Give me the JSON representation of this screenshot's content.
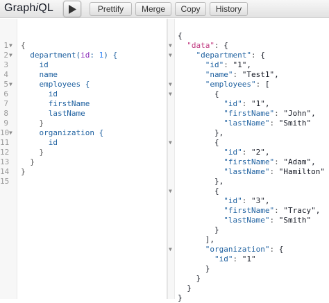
{
  "app": {
    "logo_prefix": "Graph",
    "logo_i": "i",
    "logo_suffix": "QL"
  },
  "toolbar": {
    "execute_icon": "play-icon",
    "buttons": [
      {
        "label": "Prettify"
      },
      {
        "label": "Merge"
      },
      {
        "label": "Copy"
      },
      {
        "label": "History"
      }
    ]
  },
  "query": {
    "line_numbers": [
      "1",
      "2",
      "3",
      "4",
      "5",
      "6",
      "7",
      "8",
      "9",
      "10",
      "11",
      "12",
      "13",
      "14",
      "15"
    ],
    "lines": [
      "{",
      "  department(id: 1) {",
      "    id",
      "    name",
      "    employees {",
      "      id",
      "      firstName",
      "      lastName",
      "    }",
      "    organization {",
      "      id",
      "    }",
      "  }",
      "}",
      ""
    ]
  },
  "result": {
    "lines": [
      "{",
      "  \"data\": {",
      "    \"department\": {",
      "      \"id\": \"1\",",
      "      \"name\": \"Test1\",",
      "      \"employees\": [",
      "        {",
      "          \"id\": \"1\",",
      "          \"firstName\": \"John\",",
      "          \"lastName\": \"Smith\"",
      "        },",
      "        {",
      "          \"id\": \"2\",",
      "          \"firstName\": \"Adam\",",
      "          \"lastName\": \"Hamilton\"",
      "        },",
      "        {",
      "          \"id\": \"3\",",
      "          \"firstName\": \"Tracy\",",
      "          \"lastName\": \"Smith\"",
      "        }",
      "      ],",
      "      \"organization\": {",
      "        \"id\": \"1\"",
      "      }",
      "    }",
      "  }",
      "}"
    ]
  }
}
